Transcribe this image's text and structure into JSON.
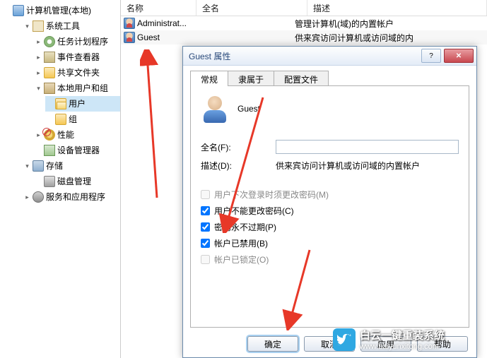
{
  "tree": {
    "root": "计算机管理(本地)",
    "system_tools": "系统工具",
    "task_scheduler": "任务计划程序",
    "event_viewer": "事件查看器",
    "shared_folders": "共享文件夹",
    "local_users_groups": "本地用户和组",
    "users": "用户",
    "groups": "组",
    "performance": "性能",
    "device_manager": "设备管理器",
    "storage": "存储",
    "disk_management": "磁盘管理",
    "services_apps": "服务和应用程序"
  },
  "list": {
    "col_name": "名称",
    "col_fullname": "全名",
    "col_desc": "描述",
    "rows": [
      {
        "name": "Administrat...",
        "full": "",
        "desc": "管理计算机(域)的内置帐户"
      },
      {
        "name": "Guest",
        "full": "",
        "desc": "供来宾访问计算机或访问域的内"
      }
    ]
  },
  "dialog": {
    "title": "Guest 属性",
    "tabs": {
      "general": "常规",
      "member": "隶属于",
      "profile": "配置文件"
    },
    "username": "Guest",
    "fullname_label": "全名(F):",
    "fullname_value": "",
    "desc_label": "描述(D):",
    "desc_value": "供来宾访问计算机或访问域的内置帐户",
    "chk_mustchange": "用户下次登录时须更改密码(M)",
    "chk_cannotchange": "用户不能更改密码(C)",
    "chk_neverexpire": "密码永不过期(P)",
    "chk_disabled": "帐户已禁用(B)",
    "chk_locked": "帐户已锁定(O)",
    "btn_ok": "确定",
    "btn_cancel": "取消",
    "btn_apply": "应用",
    "btn_help": "帮助"
  },
  "watermark": {
    "brand": "白云一键重装系统",
    "site": "www.baiyunxitong.com"
  }
}
